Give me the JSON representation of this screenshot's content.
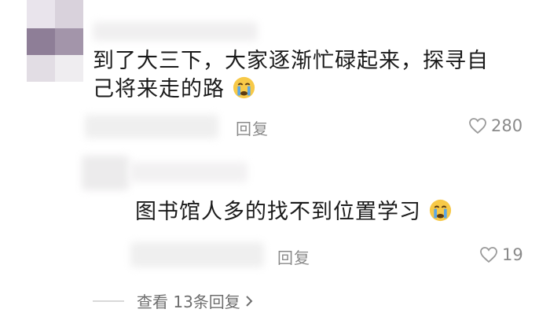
{
  "comments": [
    {
      "text_line1": "到了大三下，大家逐渐忙碌起来，探寻自",
      "text_line2": "己将来走的路",
      "emoji": "crying-face-icon",
      "reply_label": "回复",
      "likes": "280"
    },
    {
      "text": "图书馆人多的找不到位置学习",
      "emoji": "crying-face-icon",
      "reply_label": "回复",
      "likes": "19"
    }
  ],
  "view_more_label": "查看 13条回复",
  "colors": {
    "text": "#1a1a1a",
    "secondary": "#8a8a8a",
    "emoji_face": "#f7c948",
    "emoji_tear": "#5aa7e6"
  }
}
